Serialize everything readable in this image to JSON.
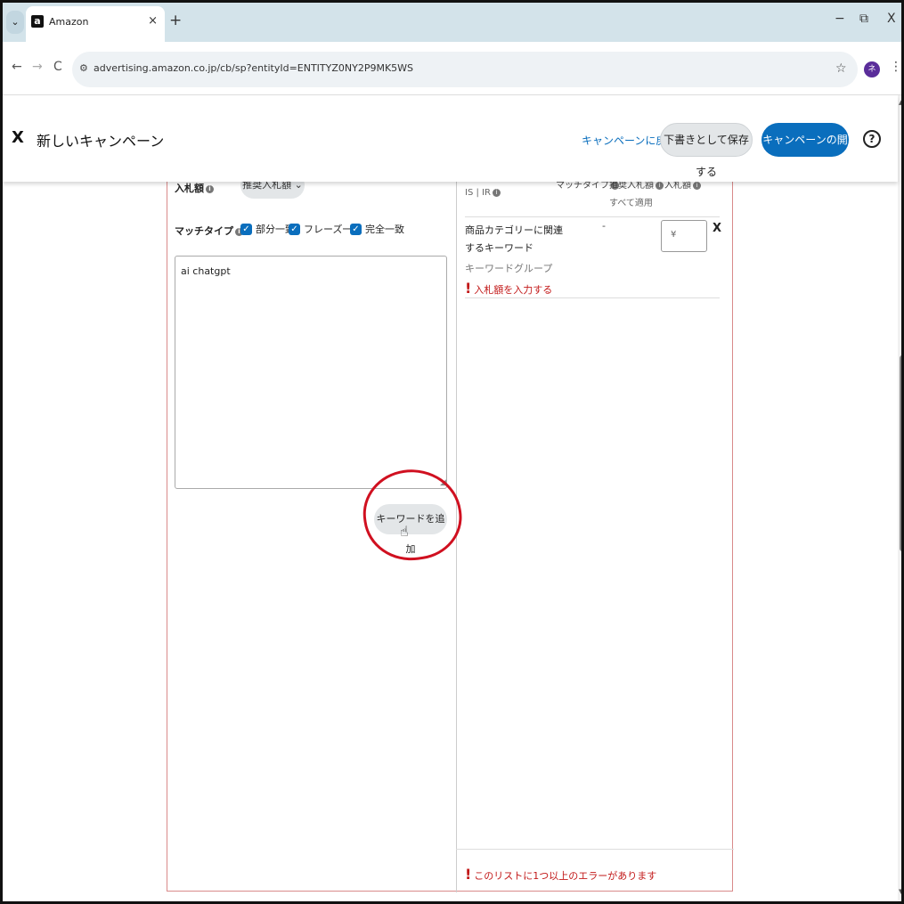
{
  "browser": {
    "tab_menu_glyph": "⌄",
    "tab_title": "Amazon",
    "favicon_letter": "a",
    "tab_close": "×",
    "new_tab": "+",
    "window_min": "−",
    "window_restore": "⧉",
    "window_close": "X",
    "back": "←",
    "forward": "→",
    "reload": "C",
    "url": "advertising.amazon.co.jp/cb/sp?entityId=ENTITYZ0NY2P9MK5WS",
    "avatar_letter": "ネ"
  },
  "header": {
    "close": "X",
    "title": "新しいキャンペーン",
    "back_link": "キャンペーンに戻る",
    "save_draft": "下書きとして保存する",
    "launch": "キャンペーンの開始",
    "help": "?"
  },
  "left": {
    "bid_label": "入札額",
    "bid_select": "推奨入札額 ⌄",
    "match_type_label": "マッチタイプ",
    "checkboxes": [
      "部分一致",
      "フレーズ一致",
      "完全一致"
    ],
    "keywords_text": "ai chatgpt",
    "add_keyword_button": "キーワードを追加"
  },
  "right": {
    "col_is_ir": "IS | IR",
    "col_match_type": "マッチタイプ",
    "col_suggested_bid": "推奨入札額",
    "col_bid": "入札額",
    "apply_all": "すべて適用",
    "row": {
      "keyword": "商品カテゴリーに関連するキーワード",
      "keyword_group": "キーワードグループ",
      "suggested": "-",
      "bid_placeholder": "¥",
      "remove": "X",
      "bid_error": "入札額を入力する"
    },
    "list_error": "このリストに1つ以上のエラーがあります"
  },
  "colors": {
    "primary": "#0a6ebd",
    "error": "#c21818",
    "annotation": "#d01020"
  }
}
